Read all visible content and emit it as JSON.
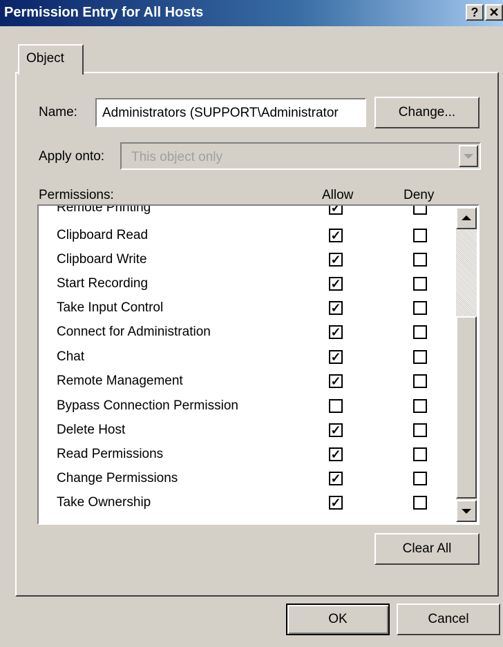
{
  "window": {
    "title": "Permission Entry for All Hosts",
    "help_label": "?",
    "close_label": "✕"
  },
  "tabs": [
    {
      "label": "Object"
    }
  ],
  "name_field": {
    "label": "Name:",
    "value": "Administrators (SUPPORT\\Administrator",
    "change_label": "Change..."
  },
  "apply_onto": {
    "label": "Apply onto:",
    "value": "This object only"
  },
  "permissions": {
    "label": "Permissions:",
    "allow_header": "Allow",
    "deny_header": "Deny",
    "rows": [
      {
        "name": "Remote Printing",
        "allow": true,
        "deny": false
      },
      {
        "name": "Clipboard Read",
        "allow": true,
        "deny": false
      },
      {
        "name": "Clipboard Write",
        "allow": true,
        "deny": false
      },
      {
        "name": "Start Recording",
        "allow": true,
        "deny": false
      },
      {
        "name": "Take Input Control",
        "allow": true,
        "deny": false
      },
      {
        "name": "Connect for Administration",
        "allow": true,
        "deny": false
      },
      {
        "name": "Chat",
        "allow": true,
        "deny": false
      },
      {
        "name": "Remote Management",
        "allow": true,
        "deny": false
      },
      {
        "name": "Bypass Connection Permission",
        "allow": false,
        "deny": false
      },
      {
        "name": "Delete Host",
        "allow": true,
        "deny": false
      },
      {
        "name": "Read Permissions",
        "allow": true,
        "deny": false
      },
      {
        "name": "Change Permissions",
        "allow": true,
        "deny": false
      },
      {
        "name": "Take Ownership",
        "allow": true,
        "deny": false
      }
    ]
  },
  "buttons": {
    "clear_all": "Clear All",
    "ok": "OK",
    "cancel": "Cancel"
  }
}
